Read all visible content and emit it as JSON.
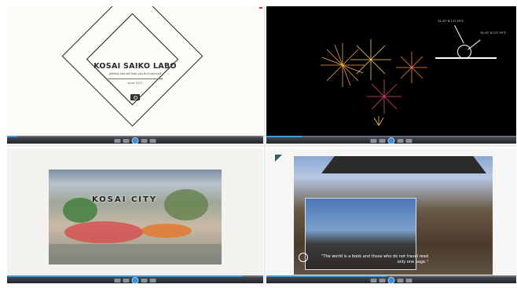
{
  "panel1": {
    "title": "KOSAI SAIKO LABO",
    "tagline": "getting lost will help you find yourself",
    "since": "since 2017"
  },
  "panel2": {
    "coords_left": "34.43° N  137.39°E",
    "coords_right": "34.43° N  137.39°E"
  },
  "panel3": {
    "title": "KOSAI CITY"
  },
  "panel4": {
    "quote_line1": "\"The world is a book and those who do not travel read",
    "quote_line2": "only one page.\""
  },
  "colors": {
    "accent": "#3a9be0",
    "bar_dark": "#23262c"
  }
}
